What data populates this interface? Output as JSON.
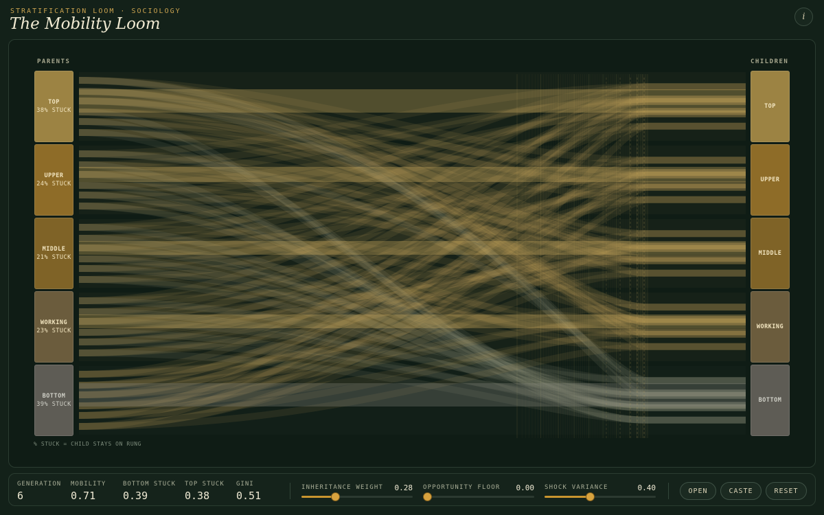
{
  "header": {
    "kicker": "STRATIFICATION LOOM · SOCIOLOGY",
    "title": "The Mobility Loom",
    "info_glyph": "i"
  },
  "loom": {
    "parents_label": "PARENTS",
    "children_label": "CHILDREN",
    "legend": "% STUCK = CHILD STAYS ON RUNG",
    "parents": [
      {
        "name": "TOP",
        "stuck": "38% STUCK",
        "color": "#9c8343"
      },
      {
        "name": "UPPER",
        "stuck": "24% STUCK",
        "color": "#8e6c28"
      },
      {
        "name": "MIDDLE",
        "stuck": "21% STUCK",
        "color": "#7f6327"
      },
      {
        "name": "WORKING",
        "stuck": "23% STUCK",
        "color": "#6b5c3d"
      },
      {
        "name": "BOTTOM",
        "stuck": "39% STUCK",
        "color": "#5e5c55"
      }
    ],
    "children": [
      {
        "name": "TOP",
        "color": "#9c8343"
      },
      {
        "name": "UPPER",
        "color": "#8e6c28"
      },
      {
        "name": "MIDDLE",
        "color": "#7f6327"
      },
      {
        "name": "WORKING",
        "color": "#6b5c3d"
      },
      {
        "name": "BOTTOM",
        "color": "#5e5c55"
      }
    ]
  },
  "stats": [
    {
      "label": "GENERATION",
      "value": "6"
    },
    {
      "label": "MOBILITY",
      "value": "0.71"
    },
    {
      "label": "BOTTOM STUCK",
      "value": "0.39"
    },
    {
      "label": "TOP STUCK",
      "value": "0.38"
    },
    {
      "label": "GINI",
      "value": "0.51"
    }
  ],
  "sliders": [
    {
      "label": "INHERITANCE WEIGHT",
      "value": "0.28",
      "fraction": 0.3
    },
    {
      "label": "OPPORTUNITY FLOOR",
      "value": "0.00",
      "fraction": 0.0
    },
    {
      "label": "SHOCK VARIANCE",
      "value": "0.40",
      "fraction": 0.41
    }
  ],
  "buttons": {
    "open": "OPEN",
    "caste": "CASTE",
    "reset": "RESET"
  },
  "colors": {
    "accent": "#c9a24f",
    "thread": "#d9b565",
    "background": "#132119"
  }
}
